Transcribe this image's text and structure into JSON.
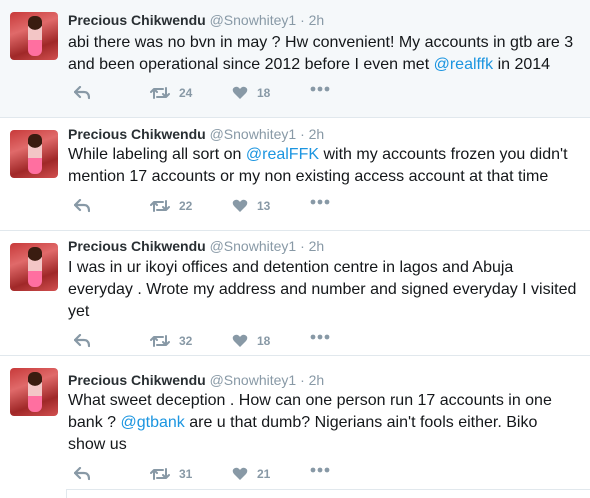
{
  "tweets": [
    {
      "name": "Precious Chikwendu",
      "handle": "@Snowhitey1",
      "dot": "·",
      "time": "2h",
      "text_parts": [
        {
          "t": "abi there was no bvn in may ? Hw convenient! My accounts in gtb are 3 and  been operational since 2012 before I even met ",
          "m": false
        },
        {
          "t": "@realffk",
          "m": true
        },
        {
          "t": " in 2014",
          "m": false
        }
      ],
      "retweets": "24",
      "likes": "18"
    },
    {
      "name": "Precious Chikwendu",
      "handle": "@Snowhitey1",
      "dot": "·",
      "time": "2h",
      "text_parts": [
        {
          "t": "While labeling all sort on ",
          "m": false
        },
        {
          "t": "@realFFK",
          "m": true
        },
        {
          "t": " with my accounts frozen you didn't mention 17 accounts or my non existing access account at that time",
          "m": false
        }
      ],
      "retweets": "22",
      "likes": "13"
    },
    {
      "name": "Precious Chikwendu",
      "handle": "@Snowhitey1",
      "dot": "·",
      "time": "2h",
      "text_parts": [
        {
          "t": "I was in ur ikoyi offices and detention centre in lagos and Abuja everyday . Wrote my address and number and signed everyday I visited yet",
          "m": false
        }
      ],
      "retweets": "32",
      "likes": "18"
    },
    {
      "name": "Precious Chikwendu",
      "handle": "@Snowhitey1",
      "dot": "·",
      "time": "2h",
      "text_parts": [
        {
          "t": "What sweet deception . How can one person run 17 accounts in one bank ? ",
          "m": false
        },
        {
          "t": "@gtbank",
          "m": true
        },
        {
          "t": " are u that dumb? Nigerians ain't fools either.  Biko show us",
          "m": false
        }
      ],
      "retweets": "31",
      "likes": "21"
    }
  ],
  "icons": {
    "reply": "reply-icon",
    "retweet": "retweet-icon",
    "like": "heart-icon",
    "more": "more-icon"
  },
  "colors": {
    "mention": "#1b95e0",
    "muted": "#8899a6",
    "highlight_bg": "#f5f8fa",
    "border": "#e1e8ed"
  }
}
